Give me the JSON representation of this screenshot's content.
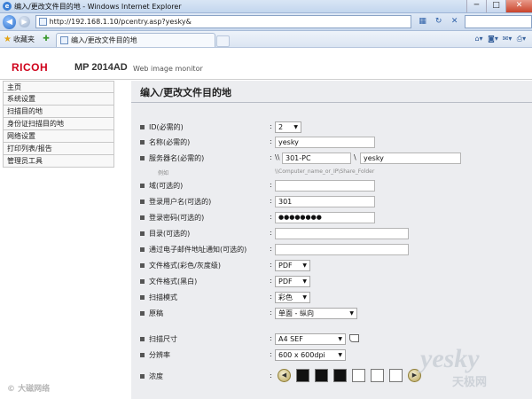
{
  "window": {
    "title": "编入/更改文件目的地 - Windows Internet Explorer",
    "minimize": "─",
    "maximize": "□",
    "close": "✕"
  },
  "address_bar": {
    "url": "http://192.168.1.10/pcentry.asp?yesky&",
    "search_placeholder": ""
  },
  "favorites_bar": {
    "favorites_label": "收藏夹",
    "tab_title": "编入/更改文件目的地"
  },
  "page_header": {
    "logo": "RICOH",
    "model": "MP 2014AD",
    "subtitle": "Web image monitor"
  },
  "sidebar": {
    "items": [
      {
        "label": "主页"
      },
      {
        "label": "系统设置"
      },
      {
        "label": "扫描目的地"
      },
      {
        "label": "身份证扫描目的地"
      },
      {
        "label": "网络设置"
      },
      {
        "label": "打印列表/报告"
      },
      {
        "label": "管理员工具"
      }
    ]
  },
  "main": {
    "title": "编入/更改文件目的地",
    "fields": {
      "id_label": "ID(必需的)",
      "id_value": "2",
      "name_label": "名称(必需的)",
      "name_value": "yesky",
      "server_label": "服务器名(必需的)",
      "server_prefix": "\\\\",
      "server_value": "301-PC",
      "folder_sep": "\\",
      "folder_value": "yesky",
      "example_label": "例如",
      "example_hint": "\\\\Computer_name_or_IP\\Share_Folder",
      "domain_label": "域(可选的)",
      "domain_value": "",
      "login_user_label": "登录用户名(可选的)",
      "login_user_value": "301",
      "login_pass_label": "登录密码(可选的)",
      "login_pass_value": "●●●●●●●●",
      "directory_label": "目录(可选的)",
      "directory_value": "",
      "notify_email_label": "通过电子邮件地址通知(可选的)",
      "notify_email_value": "",
      "format_color_label": "文件格式(彩色/灰度级)",
      "format_color_value": "PDF",
      "format_bw_label": "文件格式(黑白)",
      "format_bw_value": "PDF",
      "scan_mode_label": "扫描模式",
      "scan_mode_value": "彩色",
      "original_label": "原稿",
      "original_value": "单面 - 纵向",
      "scan_size_label": "扫描尺寸",
      "scan_size_value": "A4 SEF",
      "resolution_label": "分辨率",
      "resolution_value": "600 x 600dpi",
      "density_label": "浓度",
      "density_level": 0.5
    }
  },
  "watermarks": {
    "bottom_left": "© 大磁网络",
    "bottom_right_en": "yesky",
    "bottom_right_cn": "天极网"
  }
}
